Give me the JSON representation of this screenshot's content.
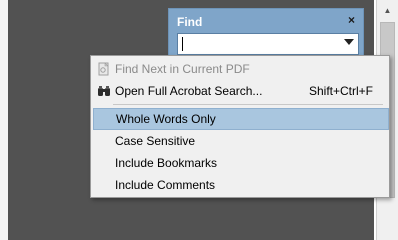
{
  "find_panel": {
    "title": "Find",
    "close_glyph": "×",
    "search_value": ""
  },
  "menu": {
    "items": [
      {
        "label": "Find Next in Current PDF",
        "disabled": true,
        "icon": "find-next-icon"
      },
      {
        "label": "Open Full Acrobat Search...",
        "shortcut": "Shift+Ctrl+F",
        "icon": "binoculars-icon"
      },
      {
        "label": "Whole Words Only",
        "highlighted": true
      },
      {
        "label": "Case Sensitive"
      },
      {
        "label": "Include Bookmarks"
      },
      {
        "label": "Include Comments"
      }
    ]
  },
  "colors": {
    "canvas": "#525252",
    "find_panel": "#7fa5c9",
    "menu_bg": "#f0f0f0",
    "highlight": "#a9c6df"
  }
}
